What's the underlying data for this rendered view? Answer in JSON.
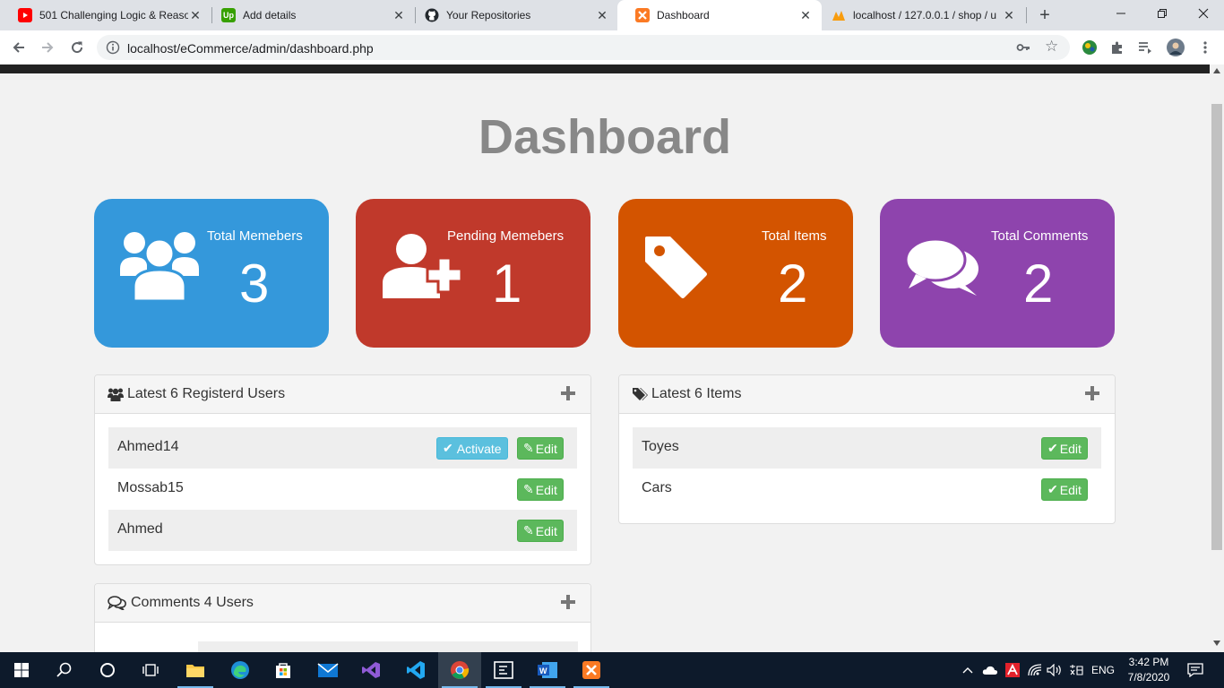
{
  "browser": {
    "tabs": [
      {
        "title": "501 Challenging Logic & Reaso",
        "icon": "youtube-icon"
      },
      {
        "title": "Add details",
        "icon": "upwork-icon"
      },
      {
        "title": "Your Repositories",
        "icon": "github-icon"
      },
      {
        "title": "Dashboard",
        "icon": "xampp-icon"
      },
      {
        "title": "localhost / 127.0.0.1 / shop / u",
        "icon": "phpmyadmin-icon"
      }
    ],
    "url": "localhost/eCommerce/admin/dashboard.php"
  },
  "page": {
    "title": "Dashboard",
    "stats": [
      {
        "label": "Total Memebers",
        "value": "3",
        "color": "#3498db",
        "icon": "users-icon"
      },
      {
        "label": "Pending Memebers",
        "value": "1",
        "color": "#c0392b",
        "icon": "user-plus-icon"
      },
      {
        "label": "Total Items",
        "value": "2",
        "color": "#d35400",
        "icon": "tag-icon"
      },
      {
        "label": "Total Comments",
        "value": "2",
        "color": "#8e44ad",
        "icon": "comments-icon"
      }
    ],
    "users_panel": {
      "title": "Latest 6 Registerd Users",
      "rows": [
        {
          "name": "Ahmed14",
          "activate": "Activate",
          "edit": "Edit"
        },
        {
          "name": "Mossab15",
          "edit": "Edit"
        },
        {
          "name": "Ahmed",
          "edit": "Edit"
        }
      ]
    },
    "items_panel": {
      "title": "Latest 6 Items",
      "rows": [
        {
          "name": "Toyes",
          "edit": "Edit"
        },
        {
          "name": "Cars",
          "edit": "Edit"
        }
      ]
    },
    "comments_panel": {
      "title": "Comments 4 Users"
    }
  },
  "taskbar": {
    "language": "ENG",
    "time": "3:42 PM",
    "date": "7/8/2020"
  }
}
